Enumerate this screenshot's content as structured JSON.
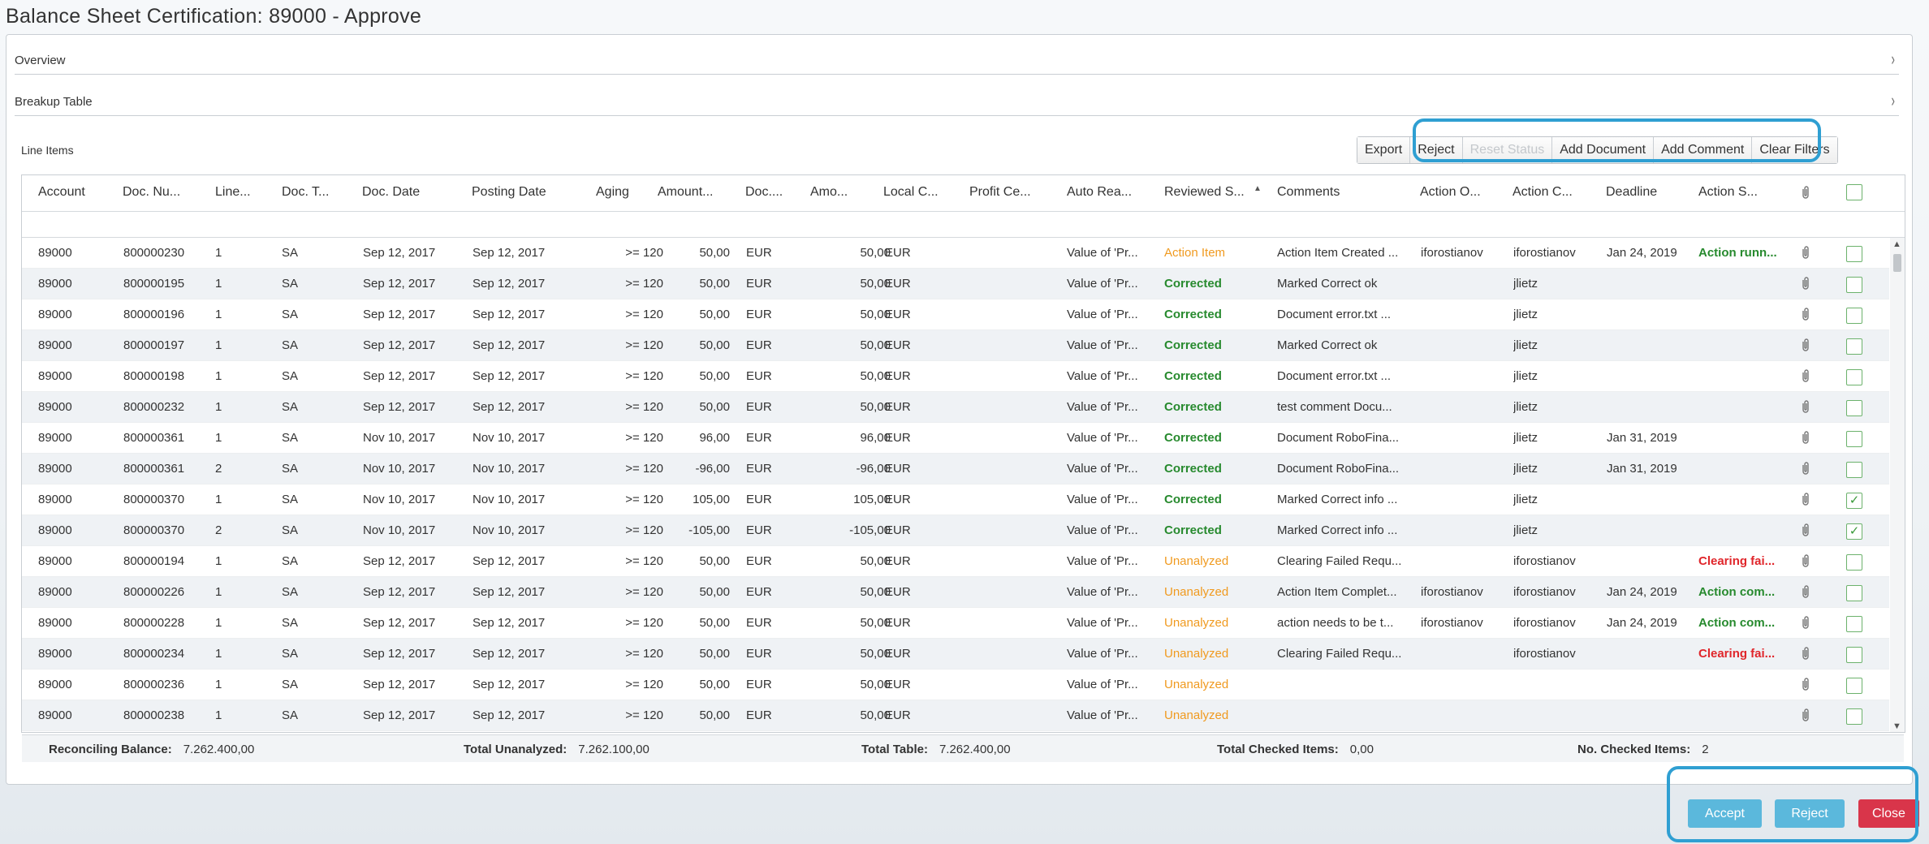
{
  "page": {
    "title": "Balance Sheet Certification: 89000 - Approve"
  },
  "sections": {
    "overview": "Overview",
    "breakup": "Breakup Table",
    "chevron": "›"
  },
  "line_items": {
    "label": "Line Items"
  },
  "toolbar": {
    "export": "Export",
    "reject": "Reject",
    "reset_status": "Reset Status",
    "add_document": "Add Document",
    "add_comment": "Add Comment",
    "clear_filters": "Clear Filters"
  },
  "columns": [
    "Account",
    "Doc. Nu...",
    "Line...",
    "Doc. T...",
    "Doc. Date",
    "Posting Date",
    "Aging",
    "Amount...",
    "Doc....",
    "Amo...",
    "Local C...",
    "Profit Ce...",
    "Auto Rea...",
    "Reviewed S...",
    "Comments",
    "Action O...",
    "Action C...",
    "Deadline",
    "Action S..."
  ],
  "rows": [
    {
      "account": "89000",
      "doc": "800000230",
      "line": "1",
      "type": "SA",
      "doc_date": "Sep 12, 2017",
      "post_date": "Sep 12, 2017",
      "aging": ">= 120",
      "amount": "50,00",
      "cur": "EUR",
      "amo": "50,00",
      "local": "EUR",
      "auto": "Value of 'Pr...",
      "reviewed": "Action Item",
      "rv_class": "st-orange",
      "comment": "Action Item Created ...",
      "action_o": "iforostianov",
      "action_c": "iforostianov",
      "deadline": "Jan 24, 2019",
      "action_s": "Action runn...",
      "as_class": "st-green",
      "checked": false
    },
    {
      "account": "89000",
      "doc": "800000195",
      "line": "1",
      "type": "SA",
      "doc_date": "Sep 12, 2017",
      "post_date": "Sep 12, 2017",
      "aging": ">= 120",
      "amount": "50,00",
      "cur": "EUR",
      "amo": "50,00",
      "local": "EUR",
      "auto": "Value of 'Pr...",
      "reviewed": "Corrected",
      "rv_class": "st-green",
      "comment": "Marked Correct ok",
      "action_o": "",
      "action_c": "jlietz",
      "deadline": "",
      "action_s": "",
      "as_class": "",
      "checked": false
    },
    {
      "account": "89000",
      "doc": "800000196",
      "line": "1",
      "type": "SA",
      "doc_date": "Sep 12, 2017",
      "post_date": "Sep 12, 2017",
      "aging": ">= 120",
      "amount": "50,00",
      "cur": "EUR",
      "amo": "50,00",
      "local": "EUR",
      "auto": "Value of 'Pr...",
      "reviewed": "Corrected",
      "rv_class": "st-green",
      "comment": "Document error.txt ...",
      "action_o": "",
      "action_c": "jlietz",
      "deadline": "",
      "action_s": "",
      "as_class": "",
      "checked": false
    },
    {
      "account": "89000",
      "doc": "800000197",
      "line": "1",
      "type": "SA",
      "doc_date": "Sep 12, 2017",
      "post_date": "Sep 12, 2017",
      "aging": ">= 120",
      "amount": "50,00",
      "cur": "EUR",
      "amo": "50,00",
      "local": "EUR",
      "auto": "Value of 'Pr...",
      "reviewed": "Corrected",
      "rv_class": "st-green",
      "comment": "Marked Correct ok",
      "action_o": "",
      "action_c": "jlietz",
      "deadline": "",
      "action_s": "",
      "as_class": "",
      "checked": false
    },
    {
      "account": "89000",
      "doc": "800000198",
      "line": "1",
      "type": "SA",
      "doc_date": "Sep 12, 2017",
      "post_date": "Sep 12, 2017",
      "aging": ">= 120",
      "amount": "50,00",
      "cur": "EUR",
      "amo": "50,00",
      "local": "EUR",
      "auto": "Value of 'Pr...",
      "reviewed": "Corrected",
      "rv_class": "st-green",
      "comment": "Document error.txt ...",
      "action_o": "",
      "action_c": "jlietz",
      "deadline": "",
      "action_s": "",
      "as_class": "",
      "checked": false
    },
    {
      "account": "89000",
      "doc": "800000232",
      "line": "1",
      "type": "SA",
      "doc_date": "Sep 12, 2017",
      "post_date": "Sep 12, 2017",
      "aging": ">= 120",
      "amount": "50,00",
      "cur": "EUR",
      "amo": "50,00",
      "local": "EUR",
      "auto": "Value of 'Pr...",
      "reviewed": "Corrected",
      "rv_class": "st-green",
      "comment": "test comment Docu...",
      "action_o": "",
      "action_c": "jlietz",
      "deadline": "",
      "action_s": "",
      "as_class": "",
      "checked": false
    },
    {
      "account": "89000",
      "doc": "800000361",
      "line": "1",
      "type": "SA",
      "doc_date": "Nov 10, 2017",
      "post_date": "Nov 10, 2017",
      "aging": ">= 120",
      "amount": "96,00",
      "cur": "EUR",
      "amo": "96,00",
      "local": "EUR",
      "auto": "Value of 'Pr...",
      "reviewed": "Corrected",
      "rv_class": "st-green",
      "comment": "Document RoboFina...",
      "action_o": "",
      "action_c": "jlietz",
      "deadline": "Jan 31, 2019",
      "action_s": "",
      "as_class": "",
      "checked": false
    },
    {
      "account": "89000",
      "doc": "800000361",
      "line": "2",
      "type": "SA",
      "doc_date": "Nov 10, 2017",
      "post_date": "Nov 10, 2017",
      "aging": ">= 120",
      "amount": "-96,00",
      "cur": "EUR",
      "amo": "-96,00",
      "local": "EUR",
      "auto": "Value of 'Pr...",
      "reviewed": "Corrected",
      "rv_class": "st-green",
      "comment": "Document RoboFina...",
      "action_o": "",
      "action_c": "jlietz",
      "deadline": "Jan 31, 2019",
      "action_s": "",
      "as_class": "",
      "checked": false
    },
    {
      "account": "89000",
      "doc": "800000370",
      "line": "1",
      "type": "SA",
      "doc_date": "Nov 10, 2017",
      "post_date": "Nov 10, 2017",
      "aging": ">= 120",
      "amount": "105,00",
      "cur": "EUR",
      "amo": "105,00",
      "local": "EUR",
      "auto": "Value of 'Pr...",
      "reviewed": "Corrected",
      "rv_class": "st-green",
      "comment": "Marked Correct info ...",
      "action_o": "",
      "action_c": "jlietz",
      "deadline": "",
      "action_s": "",
      "as_class": "",
      "checked": true
    },
    {
      "account": "89000",
      "doc": "800000370",
      "line": "2",
      "type": "SA",
      "doc_date": "Nov 10, 2017",
      "post_date": "Nov 10, 2017",
      "aging": ">= 120",
      "amount": "-105,00",
      "cur": "EUR",
      "amo": "-105,00",
      "local": "EUR",
      "auto": "Value of 'Pr...",
      "reviewed": "Corrected",
      "rv_class": "st-green",
      "comment": "Marked Correct info ...",
      "action_o": "",
      "action_c": "jlietz",
      "deadline": "",
      "action_s": "",
      "as_class": "",
      "checked": true
    },
    {
      "account": "89000",
      "doc": "800000194",
      "line": "1",
      "type": "SA",
      "doc_date": "Sep 12, 2017",
      "post_date": "Sep 12, 2017",
      "aging": ">= 120",
      "amount": "50,00",
      "cur": "EUR",
      "amo": "50,00",
      "local": "EUR",
      "auto": "Value of 'Pr...",
      "reviewed": "Unanalyzed",
      "rv_class": "st-orange",
      "comment": "Clearing Failed Requ...",
      "action_o": "",
      "action_c": "iforostianov",
      "deadline": "",
      "action_s": "Clearing fai...",
      "as_class": "st-red",
      "checked": false
    },
    {
      "account": "89000",
      "doc": "800000226",
      "line": "1",
      "type": "SA",
      "doc_date": "Sep 12, 2017",
      "post_date": "Sep 12, 2017",
      "aging": ">= 120",
      "amount": "50,00",
      "cur": "EUR",
      "amo": "50,00",
      "local": "EUR",
      "auto": "Value of 'Pr...",
      "reviewed": "Unanalyzed",
      "rv_class": "st-orange",
      "comment": "Action Item Complet...",
      "action_o": "iforostianov",
      "action_c": "iforostianov",
      "deadline": "Jan 24, 2019",
      "action_s": "Action com...",
      "as_class": "st-green",
      "checked": false
    },
    {
      "account": "89000",
      "doc": "800000228",
      "line": "1",
      "type": "SA",
      "doc_date": "Sep 12, 2017",
      "post_date": "Sep 12, 2017",
      "aging": ">= 120",
      "amount": "50,00",
      "cur": "EUR",
      "amo": "50,00",
      "local": "EUR",
      "auto": "Value of 'Pr...",
      "reviewed": "Unanalyzed",
      "rv_class": "st-orange",
      "comment": "action needs to be t...",
      "action_o": "iforostianov",
      "action_c": "iforostianov",
      "deadline": "Jan 24, 2019",
      "action_s": "Action com...",
      "as_class": "st-green",
      "checked": false
    },
    {
      "account": "89000",
      "doc": "800000234",
      "line": "1",
      "type": "SA",
      "doc_date": "Sep 12, 2017",
      "post_date": "Sep 12, 2017",
      "aging": ">= 120",
      "amount": "50,00",
      "cur": "EUR",
      "amo": "50,00",
      "local": "EUR",
      "auto": "Value of 'Pr...",
      "reviewed": "Unanalyzed",
      "rv_class": "st-orange",
      "comment": "Clearing Failed Requ...",
      "action_o": "",
      "action_c": "iforostianov",
      "deadline": "",
      "action_s": "Clearing fai...",
      "as_class": "st-red",
      "checked": false
    },
    {
      "account": "89000",
      "doc": "800000236",
      "line": "1",
      "type": "SA",
      "doc_date": "Sep 12, 2017",
      "post_date": "Sep 12, 2017",
      "aging": ">= 120",
      "amount": "50,00",
      "cur": "EUR",
      "amo": "50,00",
      "local": "EUR",
      "auto": "Value of 'Pr...",
      "reviewed": "Unanalyzed",
      "rv_class": "st-orange",
      "comment": "",
      "action_o": "",
      "action_c": "",
      "deadline": "",
      "action_s": "",
      "as_class": "",
      "checked": false
    },
    {
      "account": "89000",
      "doc": "800000238",
      "line": "1",
      "type": "SA",
      "doc_date": "Sep 12, 2017",
      "post_date": "Sep 12, 2017",
      "aging": ">= 120",
      "amount": "50,00",
      "cur": "EUR",
      "amo": "50,00",
      "local": "EUR",
      "auto": "Value of 'Pr...",
      "reviewed": "Unanalyzed",
      "rv_class": "st-orange",
      "comment": "",
      "action_o": "",
      "action_c": "",
      "deadline": "",
      "action_s": "",
      "as_class": "",
      "checked": false
    }
  ],
  "footer": {
    "reconciling_label": "Reconciling Balance:",
    "reconciling_value": "7.262.400,00",
    "unanalyzed_label": "Total Unanalyzed:",
    "unanalyzed_value": "7.262.100,00",
    "table_label": "Total Table:",
    "table_value": "7.262.400,00",
    "checked_total_label": "Total Checked Items:",
    "checked_total_value": "0,00",
    "checked_count_label": "No. Checked Items:",
    "checked_count_value": "2"
  },
  "buttons": {
    "accept": "Accept",
    "reject": "Reject",
    "close": "Close"
  },
  "icons": {
    "attachment": "paperclip-icon",
    "sort": "sort-ascending-icon",
    "checkmark": "✓",
    "scroll_up": "▲",
    "scroll_down": "▼"
  },
  "colors": {
    "accent": "#2f9fd2",
    "corrected": "#278a2e",
    "unanalyzed": "#f09a1f",
    "failed": "#e0262b",
    "close": "#d9354a",
    "primary_button": "#5bb8dc"
  }
}
